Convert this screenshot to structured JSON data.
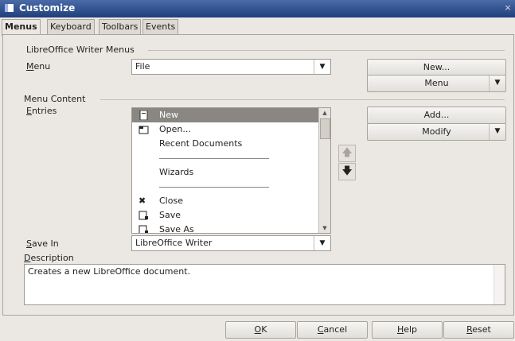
{
  "window": {
    "title": "Customize",
    "close_glyph": "×"
  },
  "tabs": [
    {
      "label": "Menus",
      "active": true
    },
    {
      "label": "Keyboard",
      "active": false
    },
    {
      "label": "Toolbars",
      "active": false
    },
    {
      "label": "Events",
      "active": false
    }
  ],
  "writer_menus": {
    "section_title": "LibreOffice Writer Menus",
    "menu_label": "Menu",
    "menu_value": "File",
    "new_button": "New...",
    "menu_button": "Menu"
  },
  "menu_content": {
    "section_title": "Menu Content",
    "entries_label": "Entries",
    "entries": [
      {
        "label": "New",
        "icon": "new-document-icon",
        "selected": true
      },
      {
        "label": "Open...",
        "icon": "open-folder-icon"
      },
      {
        "label": "Recent Documents",
        "icon": ""
      },
      {
        "separator": true
      },
      {
        "label": "Wizards",
        "icon": ""
      },
      {
        "separator": true
      },
      {
        "label": "Close",
        "icon": "close-icon"
      },
      {
        "label": "Save",
        "icon": "save-icon"
      },
      {
        "label": "Save As",
        "icon": "save-as-icon"
      }
    ],
    "add_button": "Add...",
    "modify_button": "Modify",
    "move_up_icon": "arrow-up-icon",
    "move_down_icon": "arrow-down-icon",
    "save_in_label": "Save In",
    "save_in_value": "LibreOffice Writer"
  },
  "description": {
    "label": "Description",
    "text": "Creates a new LibreOffice document."
  },
  "footer": {
    "ok": "OK",
    "cancel": "Cancel",
    "help": "Help",
    "reset": "Reset"
  }
}
